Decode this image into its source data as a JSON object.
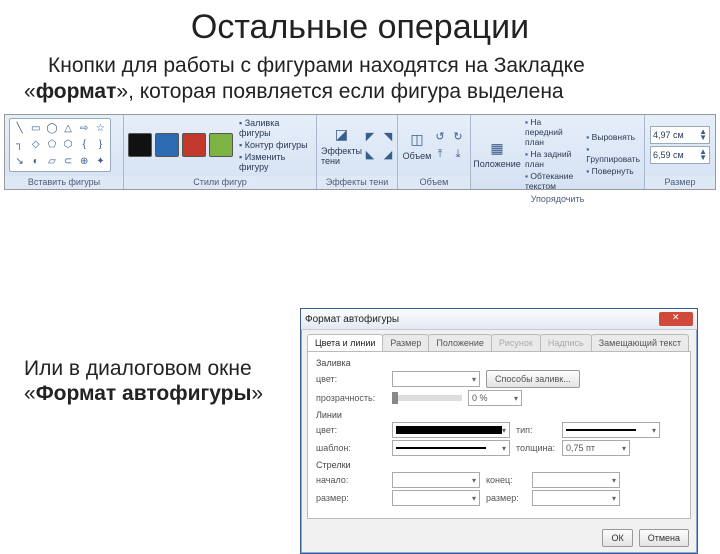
{
  "title": "Остальные операции",
  "para1_a": "Кнопки для работы с фигурами находятся на Закладке «",
  "para1_bold": "формат",
  "para1_b": "», которая появляется если фигура выделена",
  "ribbon": {
    "groups": {
      "insert": "Вставить фигуры",
      "styles": "Стили фигур",
      "shadow": "Эффекты тени",
      "volume": "Объем",
      "arrange": "Упорядочить",
      "size": "Размер"
    },
    "styles_items": {
      "fill": "Заливка фигуры",
      "outline": "Контур фигуры",
      "change": "Изменить фигуру"
    },
    "shadow_btn": "Эффекты тени",
    "volume_btn": "Объем",
    "arrange_items": {
      "position": "Положение",
      "front": "На передний план",
      "back": "На задний план",
      "wrap": "Обтекание текстом",
      "align": "Выровнять",
      "group": "Группировать",
      "rotate": "Повернуть"
    },
    "size": {
      "h": "4,97 см",
      "w": "6,59 см"
    }
  },
  "swatch_colors": [
    "#111111",
    "#2b6bb2",
    "#c0392b",
    "#7cb342"
  ],
  "para2_a": "Или в диалоговом окне «",
  "para2_bold": "Формат автофигуры",
  "para2_b": "»",
  "dialog": {
    "title": "Формат автофигуры",
    "tabs": [
      "Цвета и линии",
      "Размер",
      "Положение",
      "Рисунок",
      "Надпись",
      "Замещающий текст"
    ],
    "active_tab": 0,
    "sections": {
      "fill": "Заливка",
      "lines": "Линии",
      "arrows": "Стрелки"
    },
    "labels": {
      "color": "цвет:",
      "transparency": "прозрачность:",
      "template": "шаблон:",
      "type": "тип:",
      "thickness": "толщина:",
      "start": "начало:",
      "end": "конец:",
      "size": "размер:",
      "fill_methods": "Способы заливк..."
    },
    "values": {
      "transparency": "0 %",
      "thickness": "0,75 пт"
    },
    "buttons": {
      "ok": "ОК",
      "cancel": "Отмена"
    }
  }
}
